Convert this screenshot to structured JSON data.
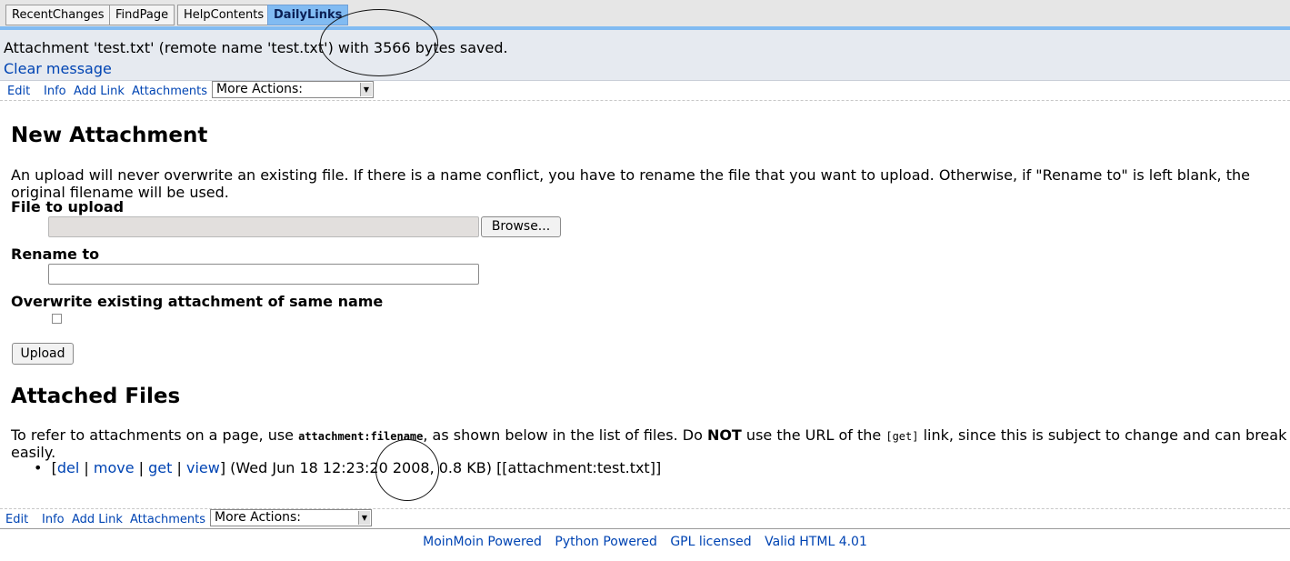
{
  "nav": {
    "tabs": [
      "RecentChanges",
      "FindPage",
      "HelpContents",
      "DailyLinks"
    ]
  },
  "message": {
    "text": "Attachment 'test.txt' (remote name 'test.txt') with 3566 bytes saved.",
    "clear": "Clear message"
  },
  "editbar": {
    "edit": "Edit",
    "info": "Info",
    "add_link": "Add Link",
    "attachments": "Attachments",
    "more_actions": "More Actions:"
  },
  "new_attachment": {
    "heading": "New Attachment",
    "description": "An upload will never overwrite an existing file. If there is a name conflict, you have to rename the file that you want to upload. Otherwise, if \"Rename to\" is left blank, the original filename will be used.",
    "file_label": "File to upload",
    "browse": "Browse...",
    "rename_label": "Rename to",
    "rename_value": "",
    "overwrite_label": "Overwrite existing attachment of same name",
    "upload": "Upload"
  },
  "attached_files": {
    "heading": "Attached Files",
    "intro_1": "To refer to attachments on a page, use ",
    "intro_code": "attachment:filename",
    "intro_2": ", as shown below in the list of files. Do ",
    "intro_not": "NOT",
    "intro_3": " use the URL of the ",
    "intro_get": "[get]",
    "intro_4": " link, since this is subject to change and can break easily.",
    "files": [
      {
        "del": "del",
        "move": "move",
        "get": "get",
        "view": "view",
        "date": "Wed Jun 18 12:23:20 2008",
        "size": "0.8 KB",
        "ref": "[[attachment:test.txt]]"
      }
    ]
  },
  "footer": {
    "links": [
      "MoinMoin Powered",
      "Python Powered",
      "GPL licensed",
      "Valid HTML 4.01"
    ]
  },
  "colors": {
    "accent": "#81bbf2",
    "link": "#0044b3",
    "message_bg": "#e6eaf0"
  }
}
